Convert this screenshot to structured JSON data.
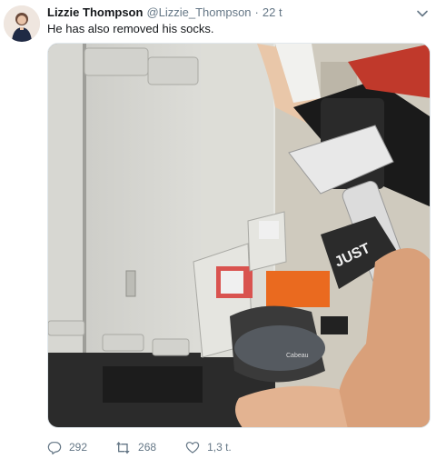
{
  "tweet": {
    "author_name": "Lizzie Thompson",
    "author_handle": "@Lizzie_Thompson",
    "separator": "·",
    "timestamp": "22 t",
    "text": "He has also removed his socks.",
    "media_description": "Photo inside airplane cabin: passenger's bare feet propped on the bulkhead wall and armrest",
    "actions": {
      "reply_count": "292",
      "retweet_count": "268",
      "like_count": "1,3 t."
    }
  },
  "colors": {
    "text_primary": "#14171a",
    "text_secondary": "#657786",
    "border": "#e1e8ed"
  },
  "icons": [
    "reply-icon",
    "retweet-icon",
    "like-icon",
    "chevron-down-icon"
  ]
}
